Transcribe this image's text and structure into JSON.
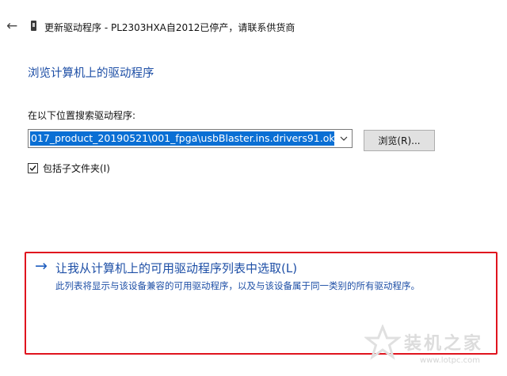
{
  "header": {
    "back_icon": "back-arrow-icon",
    "device_icon": "usb-device-icon",
    "title": "更新驱动程序 - PL2303HXA自2012已停产，请联系供货商"
  },
  "page": {
    "title": "浏览计算机上的驱动程序"
  },
  "search": {
    "label": "在以下位置搜索驱动程序:",
    "path_value": "017_product_20190521\\001_fpga\\usbBlaster.ins.drivers91.ok",
    "browse_label": "浏览(R)...",
    "include_subfolders_label": "包括子文件夹(I)",
    "include_subfolders_checked": true
  },
  "pick_option": {
    "arrow": "→",
    "title": "让我从计算机上的可用驱动程序列表中选取(L)",
    "description": "此列表将显示与该设备兼容的可用驱动程序，以及与该设备属于同一类别的所有驱动程序。"
  },
  "watermark": {
    "text": "装机之家",
    "url": "www.lotpc.com"
  },
  "colors": {
    "link_blue": "#1e4fa6",
    "selection_blue": "#0a6fd4",
    "highlight_red": "#e0141e"
  }
}
